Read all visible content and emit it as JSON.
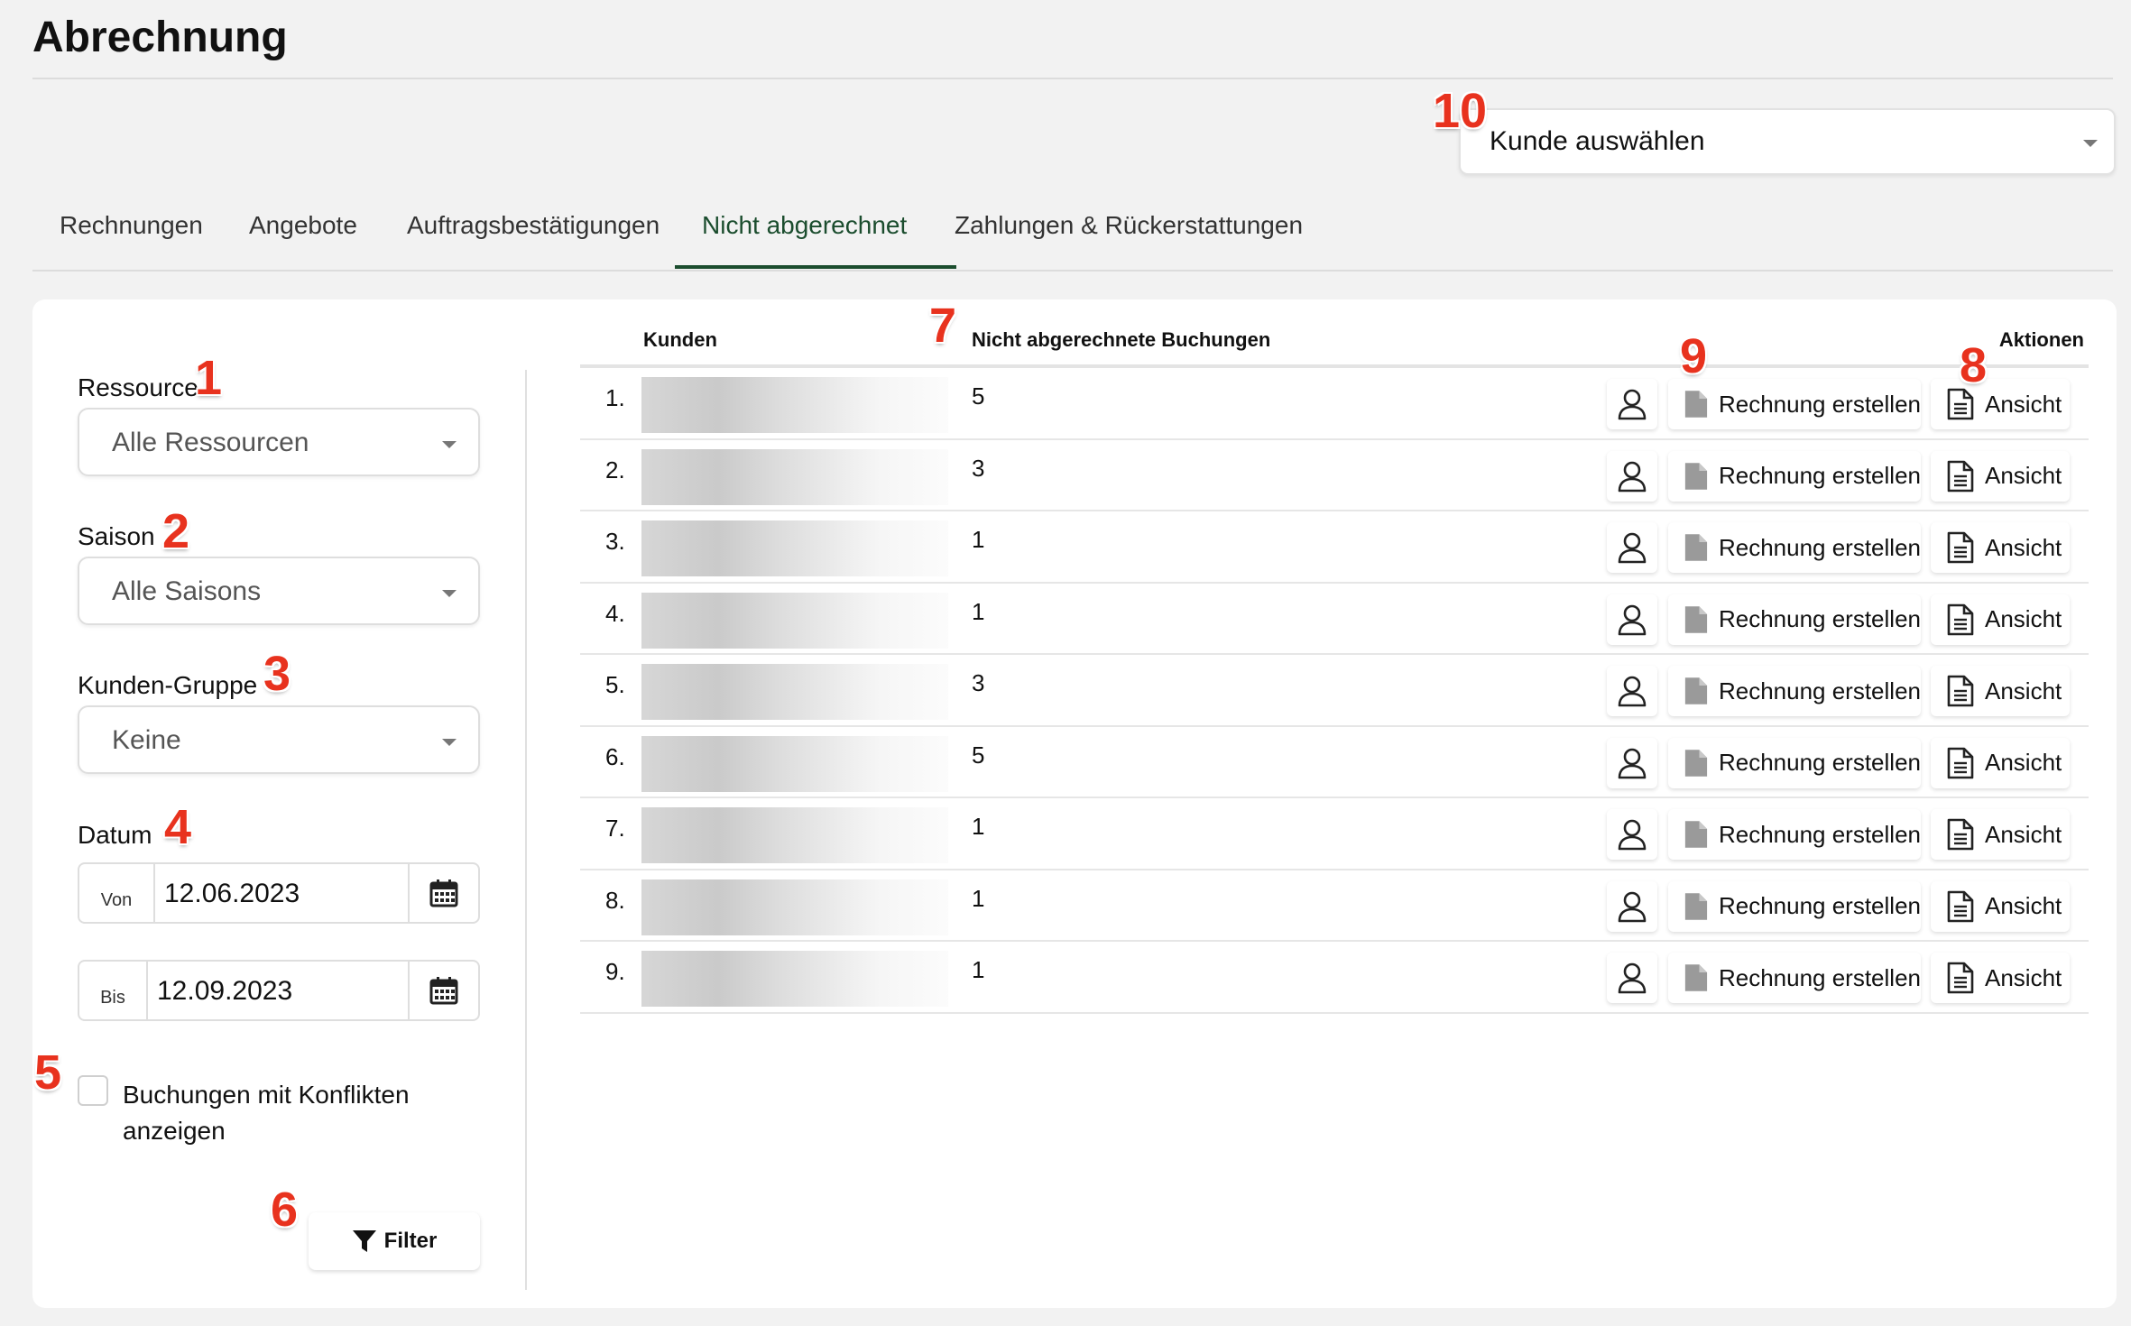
{
  "page": {
    "title": "Abrechnung"
  },
  "customer_select": {
    "value": "Kunde auswählen"
  },
  "tabs": [
    {
      "label": "Rechnungen",
      "active": false
    },
    {
      "label": "Angebote",
      "active": false
    },
    {
      "label": "Auftragsbestätigungen",
      "active": false
    },
    {
      "label": "Nicht abgerechnet",
      "active": true
    },
    {
      "label": "Zahlungen & Rückerstattungen",
      "active": false
    }
  ],
  "filters": {
    "resource": {
      "label": "Ressource",
      "value": "Alle Ressourcen"
    },
    "season": {
      "label": "Saison",
      "value": "Alle Saisons"
    },
    "customer_group": {
      "label": "Kunden-Gruppe",
      "value": "Keine"
    },
    "date": {
      "label": "Datum",
      "from_prefix": "Von",
      "from_value": "12.06.2023",
      "to_prefix": "Bis",
      "to_value": "12.09.2023"
    },
    "conflicts_checkbox": {
      "label": "Buchungen mit Konflikten anzeigen",
      "checked": false
    },
    "filter_button": {
      "label": "Filter"
    }
  },
  "table": {
    "headers": {
      "customers": "Kunden",
      "unbilled": "Nicht abgerechnete Buchungen",
      "actions": "Aktionen"
    },
    "rows": [
      {
        "num": "1.",
        "count": "5"
      },
      {
        "num": "2.",
        "count": "3"
      },
      {
        "num": "3.",
        "count": "1"
      },
      {
        "num": "4.",
        "count": "1"
      },
      {
        "num": "5.",
        "count": "3"
      },
      {
        "num": "6.",
        "count": "5"
      },
      {
        "num": "7.",
        "count": "1"
      },
      {
        "num": "8.",
        "count": "1"
      },
      {
        "num": "9.",
        "count": "1"
      }
    ],
    "actions": {
      "invoice_label": "Rechnung erstellen",
      "view_label": "Ansicht"
    }
  },
  "annotations": [
    "1",
    "2",
    "3",
    "4",
    "5",
    "6",
    "7",
    "8",
    "9",
    "10"
  ],
  "colors": {
    "accent": "#1b4d2e",
    "marker": "#e8321e",
    "background": "#f2f2f2"
  },
  "icons": {
    "user": "user-icon",
    "invoice": "document-filled-icon",
    "view": "document-lines-icon",
    "calendar": "calendar-icon",
    "filter": "filter-icon",
    "dropdown": "caret-down-icon"
  }
}
